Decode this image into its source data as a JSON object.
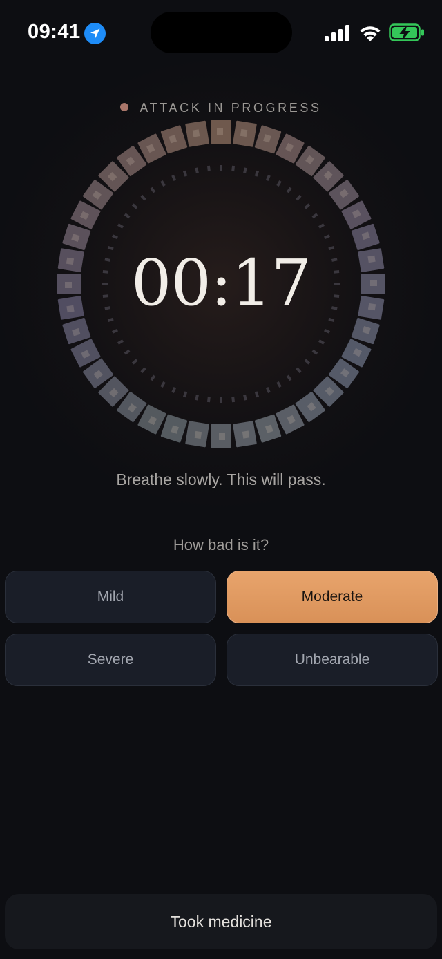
{
  "status_bar": {
    "time": "09:41"
  },
  "attack": {
    "label": "ATTACK IN PROGRESS",
    "timer": "00:17"
  },
  "messages": {
    "breathe": "Breathe slowly. This will pass.",
    "question": "How bad is it?"
  },
  "severity": {
    "options": [
      {
        "label": "Mild",
        "selected": false
      },
      {
        "label": "Moderate",
        "selected": true
      },
      {
        "label": "Severe",
        "selected": false
      },
      {
        "label": "Unbearable",
        "selected": false
      }
    ]
  },
  "actions": {
    "took_medicine": "Took medicine"
  },
  "colors": {
    "background": "#0d0e12",
    "accent": "#e09c64",
    "attack_dot": "#a9766a",
    "button_bg": "#1a1e28"
  },
  "icons": {
    "location": "location-arrow-icon",
    "signal": "cellular-signal-icon",
    "wifi": "wifi-icon",
    "battery": "battery-charging-icon"
  }
}
